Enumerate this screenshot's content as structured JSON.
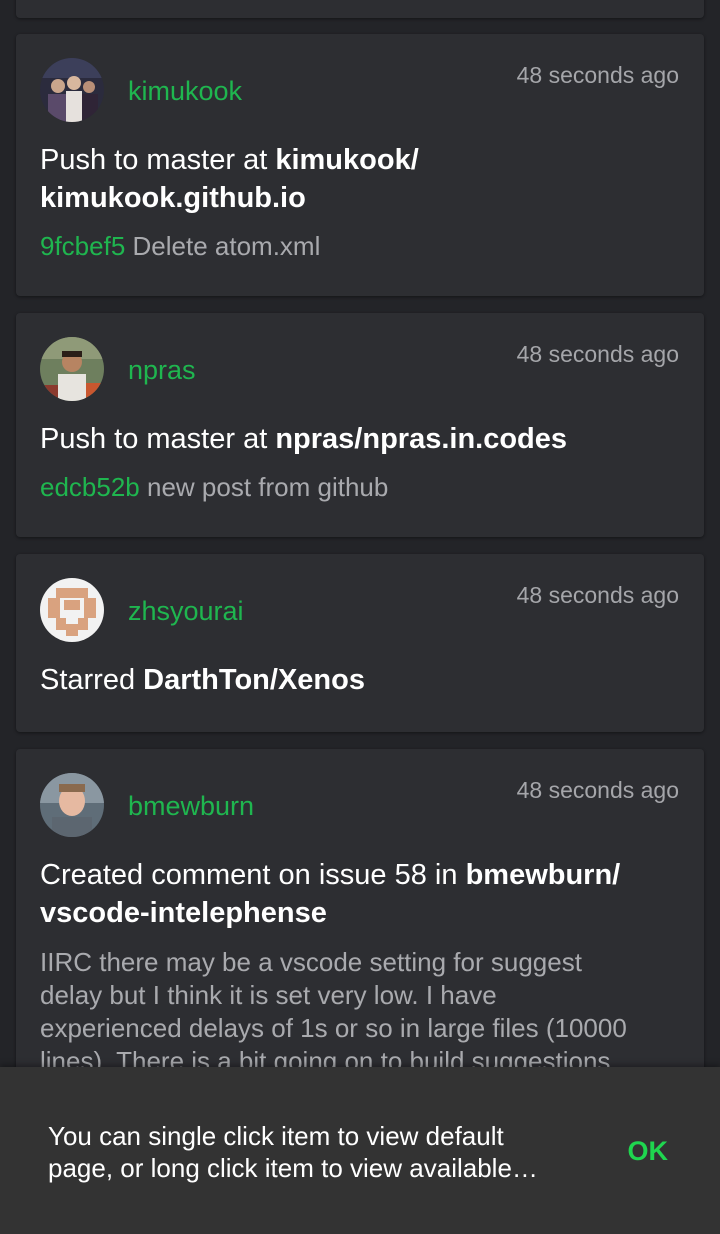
{
  "feed": [
    {
      "user": "kimukook",
      "time": "48 seconds ago",
      "action": "Push to master at ",
      "repo_line1": "kimukook/",
      "repo_line2": "kimukook.github.io",
      "sha": "9fcbef5",
      "message": "Delete atom.xml"
    },
    {
      "user": "npras",
      "time": "48 seconds ago",
      "action": "Push to master at ",
      "repo": "npras/npras.in.codes",
      "sha": "edcb52b",
      "message": "new post from github"
    },
    {
      "user": "zhsyourai",
      "time": "48 seconds ago",
      "action": "Starred ",
      "repo": "DarthTon/Xenos"
    },
    {
      "user": "bmewburn",
      "time": "48 seconds ago",
      "action": "Created comment on issue 58 in ",
      "repo_line1": "bmewburn/",
      "repo_line2": "vscode-intelephense",
      "comment_line1": "IIRC there may be a vscode setting for suggest",
      "comment_line2": "delay but I think it is set very low. I have",
      "comment_line3": "experienced delays of 1s or so in large files (10000",
      "comment_line4": "lines). There is a bit going on to build suggestions"
    }
  ],
  "snackbar": {
    "line1": "You can single click item to view default",
    "line2": "page, or long click item to view available…",
    "action": "OK"
  },
  "colors": {
    "background": "#232428",
    "card": "#2d2e32",
    "accent": "#1fb64f",
    "snackbar": "#333333"
  }
}
